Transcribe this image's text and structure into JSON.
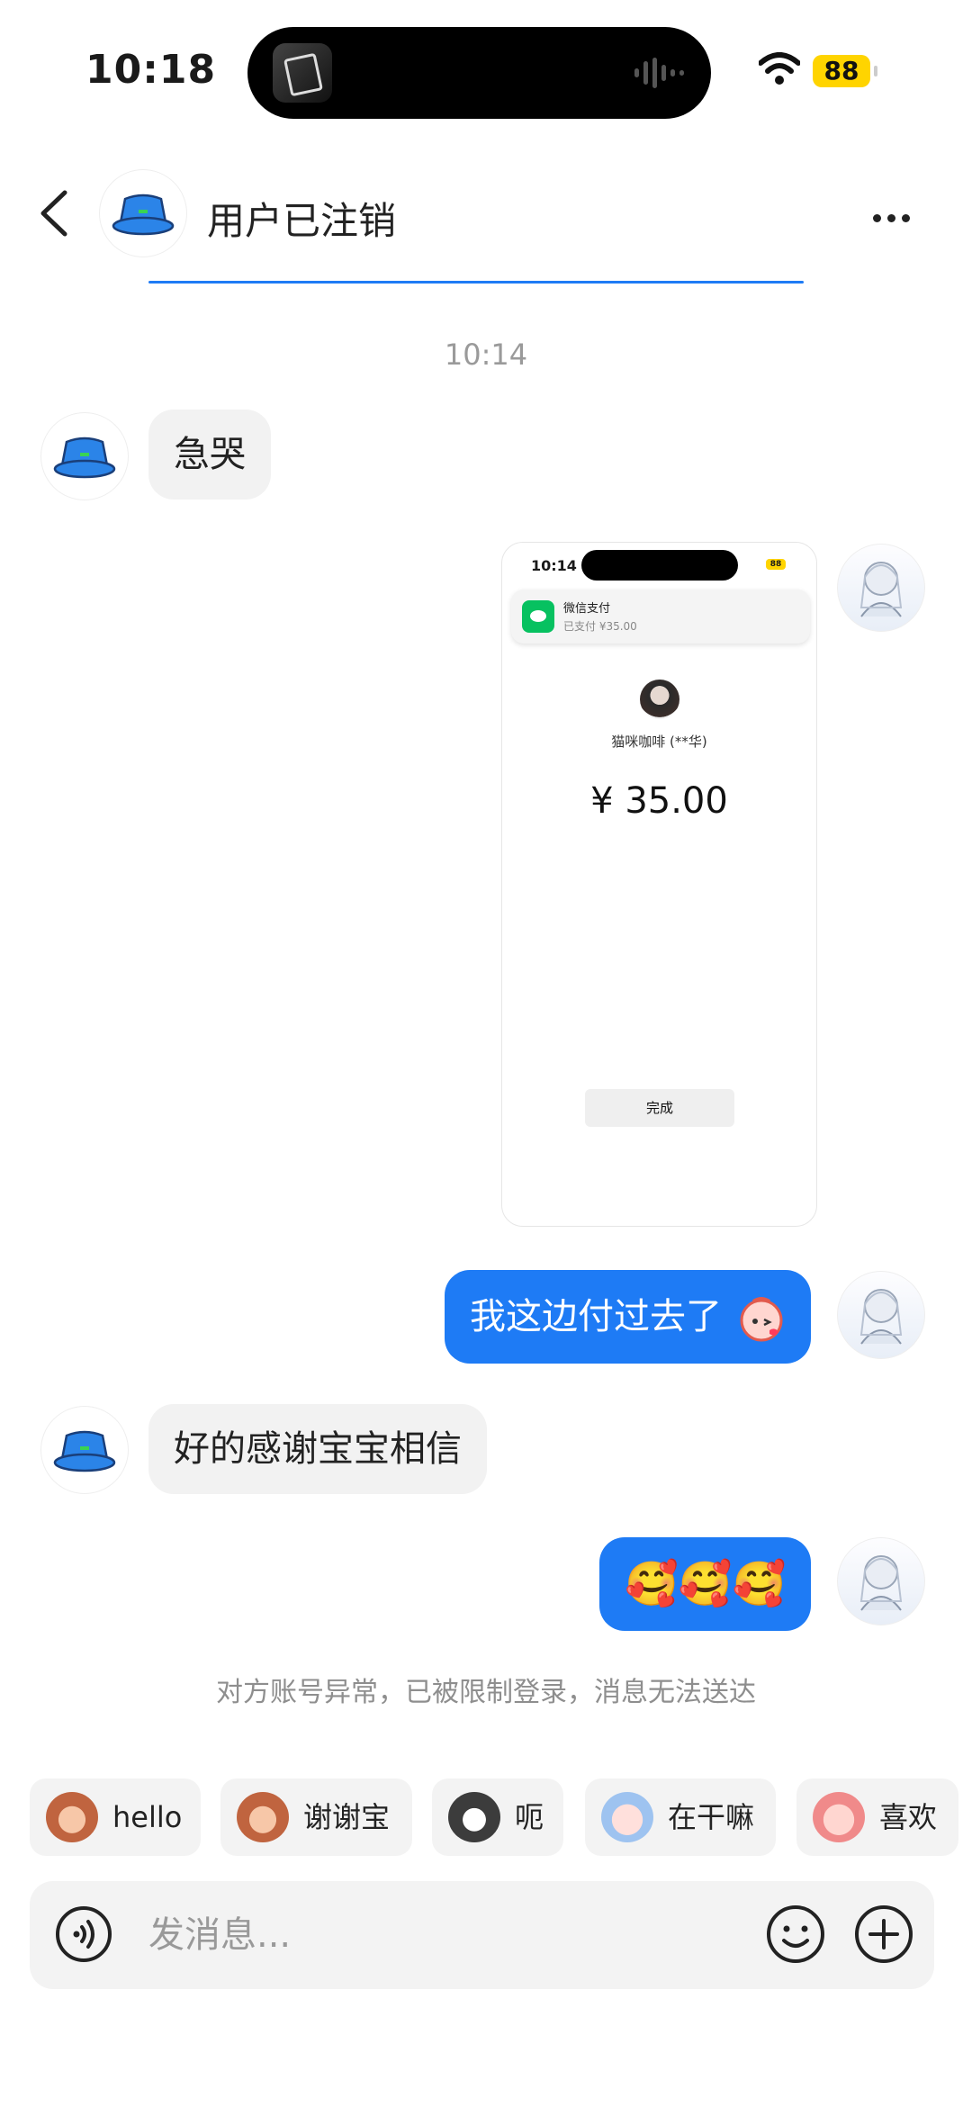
{
  "status_bar": {
    "time": "10:18",
    "battery": "88"
  },
  "header": {
    "title": "用户已注销"
  },
  "chat": {
    "timestamp": "10:14",
    "messages": [
      {
        "side": "left",
        "text": "急哭"
      },
      {
        "side": "right",
        "type": "image"
      },
      {
        "side": "right",
        "text": "我这边付过去了"
      },
      {
        "side": "left",
        "text": "好的感谢宝宝相信"
      },
      {
        "side": "right",
        "text": "🥰🥰🥰"
      }
    ],
    "screenshot": {
      "time": "10:14",
      "battery": "88",
      "notification_title": "微信支付",
      "notification_subtitle": "已支付 ¥35.00",
      "merchant": "猫咪咖啡 (**华)",
      "amount": "¥ 35.00",
      "done_button": "完成"
    },
    "notice": "对方账号异常，已被限制登录，消息无法送达"
  },
  "quick_replies": [
    "hello",
    "谢谢宝",
    "呃",
    "在干嘛",
    "喜欢"
  ],
  "input": {
    "placeholder": "发消息..."
  },
  "colors": {
    "accent": "#1e7bf5",
    "bubble_left": "#f2f2f2"
  }
}
